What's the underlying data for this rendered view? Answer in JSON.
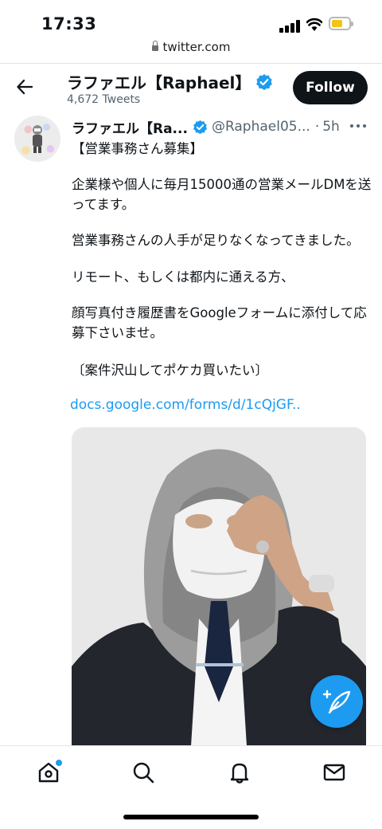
{
  "status_bar": {
    "time": "17:33"
  },
  "browser": {
    "url": "twitter.com"
  },
  "header": {
    "name": "ラファエル【Raphael】",
    "tweet_count": "4,672 Tweets",
    "follow_label": "Follow"
  },
  "tweet": {
    "author_name": "ラファエル【Ra...",
    "handle": "@Raphael05...",
    "separator": "·",
    "time": "5h",
    "lines": [
      "【営業事務さん募集】",
      "企業様や個人に毎月15000通の営業メールDMを送",
      "ってます。",
      "営業事務さんの人手が足りなくなってきました。",
      "リモート、もしくは都内に通える方、",
      "顔写真付き履歴書をGoogleフォームに添付して応",
      "募下さいませ。",
      "〔案件沢山してポケカ買いたい〕"
    ],
    "link": "docs.google.com/forms/d/1cQjGF..",
    "image_alt": "man in white mask and grey hoodie"
  },
  "colors": {
    "accent": "#1d9bf0",
    "follow_bg": "#0f1419",
    "secondary_text": "#536471"
  },
  "icons": [
    "back-arrow-icon",
    "verified-badge-icon",
    "more-icon",
    "compose-tweet-icon",
    "home-icon",
    "search-icon",
    "notifications-bell-icon",
    "messages-envelope-icon",
    "lock-icon"
  ]
}
